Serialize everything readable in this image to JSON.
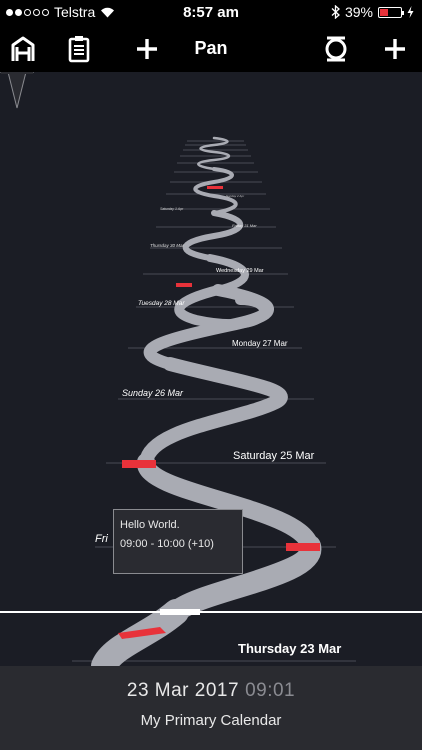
{
  "status_bar": {
    "carrier": "Telstra",
    "time": "8:57 am",
    "battery": "39%",
    "battery_level": 0.39,
    "signal_bars_filled": 2,
    "signal_bars_total": 5
  },
  "toolbar": {
    "title": "Pan",
    "home_icon": "home-icon",
    "notes_icon": "clipboard-icon",
    "add_left_icon": "plus-icon",
    "rotate_icon": "rotate-icon",
    "add_right_icon": "plus-icon"
  },
  "timeline": {
    "days": [
      {
        "label": "Thursday 23 Mar"
      },
      {
        "label": "Friday 24 Mar"
      },
      {
        "label": "Saturday 25 Mar"
      },
      {
        "label": "Sunday 26 Mar"
      },
      {
        "label": "Monday 27 Mar"
      },
      {
        "label": "Tuesday 28 Mar"
      },
      {
        "label": "Wednesday 29 Mar"
      },
      {
        "label": "Thursday 30 Mar"
      },
      {
        "label": "Friday 31 Mar"
      },
      {
        "label": "Saturday 1 Apr"
      },
      {
        "label": "Sunday 2 Apr"
      }
    ],
    "visible_friday_fragment": "Fri"
  },
  "event_tooltip": {
    "title": "Hello World.",
    "time": "09:00 - 10:00 (+10)"
  },
  "footer": {
    "date": "23 Mar 2017",
    "time": "09:01",
    "calendar": "My Primary Calendar"
  },
  "colors": {
    "background": "#1b1d25",
    "road": "#a9abb3",
    "event": "#e8323a",
    "footer": "#2a2b30"
  }
}
